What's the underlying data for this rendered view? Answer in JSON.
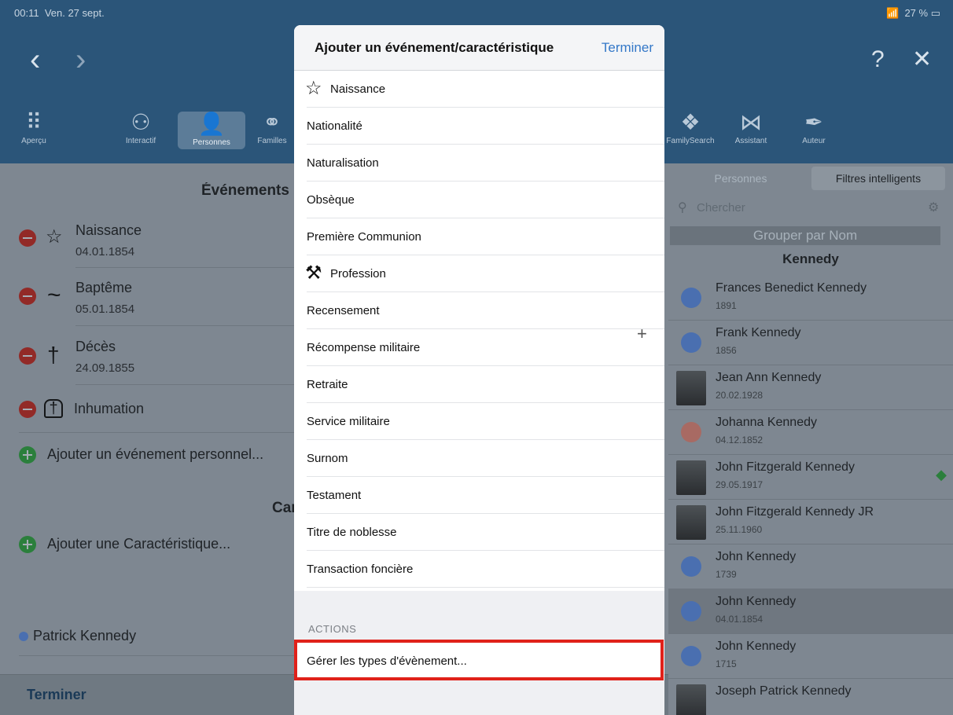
{
  "status": {
    "time": "00:11",
    "date": "Ven. 27 sept.",
    "battery": "27 %"
  },
  "header": {
    "back": "‹",
    "forward": "›",
    "help": "?",
    "close": "✕"
  },
  "toolbar": [
    {
      "label": "Aperçu"
    },
    {
      "label": "Interactif"
    },
    {
      "label": "Personnes"
    },
    {
      "label": "Familles"
    },
    {
      "label": "FamilySearch"
    },
    {
      "label": "Assistant"
    },
    {
      "label": "Auteur"
    }
  ],
  "left": {
    "events_title": "Événements",
    "events": [
      {
        "name": "Naissance",
        "date": "04.01.1854"
      },
      {
        "name": "Baptême",
        "date": "05.01.1854"
      },
      {
        "name": "Décès",
        "date": "24.09.1855"
      },
      {
        "name": "Inhumation",
        "date": ""
      }
    ],
    "add_event": "Ajouter un événement personnel...",
    "char_title": "Caractéristiques",
    "add_char": "Ajouter une Caractéristique...",
    "parent": "Patrick Kennedy",
    "done": "Terminer"
  },
  "right": {
    "tab_persons": "Personnes",
    "tab_filters": "Filtres intelligents",
    "search_placeholder": "Chercher",
    "group_header": "Grouper par Nom",
    "family_header": "Kennedy",
    "persons": [
      {
        "name": "Frances Benedict Kennedy",
        "date": "1891",
        "avatar": "#4a6fb0"
      },
      {
        "name": "Frank Kennedy",
        "date": "1856",
        "avatar": "#4a6fb0"
      },
      {
        "name": "Jean Ann Kennedy",
        "date": "20.02.1928",
        "avatar": "photo"
      },
      {
        "name": "Johanna Kennedy",
        "date": "04.12.1852",
        "avatar": "#a86a63"
      },
      {
        "name": "John Fitzgerald Kennedy",
        "date": "29.05.1917",
        "avatar": "photo"
      },
      {
        "name": "John Fitzgerald Kennedy JR",
        "date": "25.11.1960",
        "avatar": "photo"
      },
      {
        "name": "John Kennedy",
        "date": "1739",
        "avatar": "#4a6fb0"
      },
      {
        "name": "John Kennedy",
        "date": "04.01.1854",
        "avatar": "#4a6fb0"
      },
      {
        "name": "John Kennedy",
        "date": "1715",
        "avatar": "#4a6fb0"
      },
      {
        "name": "Joseph Patrick Kennedy",
        "date": "",
        "avatar": "photo"
      }
    ]
  },
  "modal": {
    "title": "Ajouter un événement/caractéristique",
    "done": "Terminer",
    "items": [
      "Naissance",
      "Nationalité",
      "Naturalisation",
      "Obsèque",
      "Première Communion",
      "Profession",
      "Recensement",
      "Récompense militaire",
      "Retraite",
      "Service militaire",
      "Surnom",
      "Testament",
      "Titre de noblesse",
      "Transaction foncière"
    ],
    "actions_label": "ACTIONS",
    "manage": "Gérer les types d'évènement..."
  }
}
